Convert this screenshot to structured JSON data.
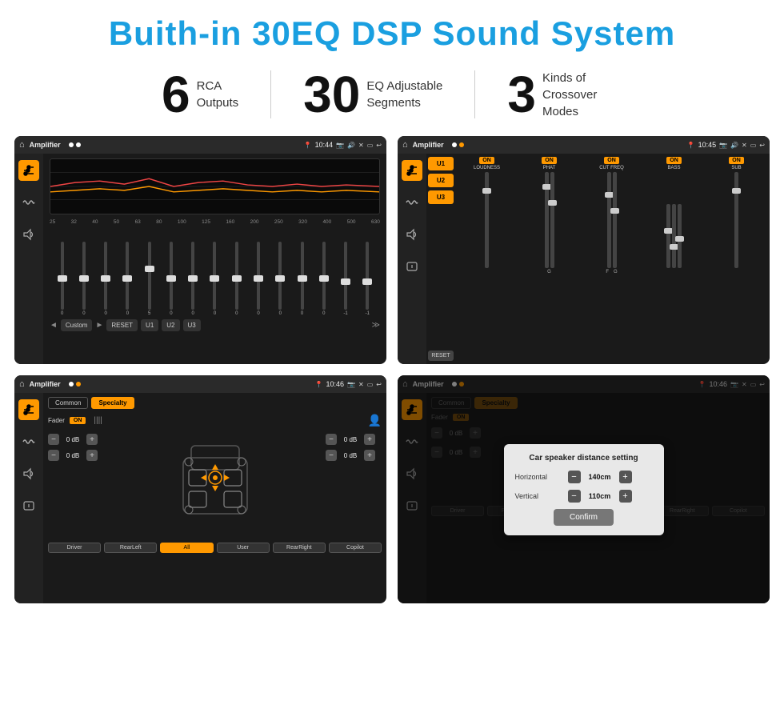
{
  "header": {
    "title": "Buith-in 30EQ DSP Sound System"
  },
  "stats": [
    {
      "number": "6",
      "text": "RCA\nOutputs"
    },
    {
      "number": "30",
      "text": "EQ Adjustable\nSegments"
    },
    {
      "number": "3",
      "text": "Kinds of\nCrossover Modes"
    }
  ],
  "screens": [
    {
      "id": "eq-screen",
      "topbar": {
        "title": "Amplifier",
        "time": "10:44"
      },
      "eq_freqs": [
        "25",
        "32",
        "40",
        "50",
        "63",
        "80",
        "100",
        "125",
        "160",
        "200",
        "250",
        "320",
        "400",
        "500",
        "630"
      ],
      "eq_values": [
        "0",
        "0",
        "0",
        "0",
        "5",
        "0",
        "0",
        "0",
        "0",
        "0",
        "0",
        "0",
        "0",
        "-1",
        "0",
        "-1"
      ],
      "preset": "Custom",
      "buttons": [
        "RESET",
        "U1",
        "U2",
        "U3"
      ]
    },
    {
      "id": "amp-screen",
      "topbar": {
        "title": "Amplifier",
        "time": "10:45"
      },
      "presets": [
        "U1",
        "U2",
        "U3"
      ],
      "channels": [
        {
          "label": "ON",
          "name": "LOUDNESS"
        },
        {
          "label": "ON",
          "name": "PHAT"
        },
        {
          "label": "ON",
          "name": "CUT FREQ"
        },
        {
          "label": "ON",
          "name": "BASS"
        },
        {
          "label": "ON",
          "name": "SUB"
        }
      ]
    },
    {
      "id": "speaker-screen",
      "topbar": {
        "title": "Amplifier",
        "time": "10:46"
      },
      "tabs": [
        "Common",
        "Specialty"
      ],
      "active_tab": "Specialty",
      "fader_label": "Fader",
      "fader_on": "ON",
      "volumes": [
        "0 dB",
        "0 dB",
        "0 dB",
        "0 dB"
      ],
      "bottom_btns": [
        "Driver",
        "",
        "RearLeft",
        "All",
        "",
        "User",
        "RearRight",
        "Copilot"
      ]
    },
    {
      "id": "dialog-screen",
      "topbar": {
        "title": "Amplifier",
        "time": "10:46"
      },
      "dialog": {
        "title": "Car speaker distance setting",
        "horizontal_label": "Horizontal",
        "horizontal_val": "140cm",
        "vertical_label": "Vertical",
        "vertical_val": "110cm",
        "confirm_label": "Confirm"
      }
    }
  ]
}
